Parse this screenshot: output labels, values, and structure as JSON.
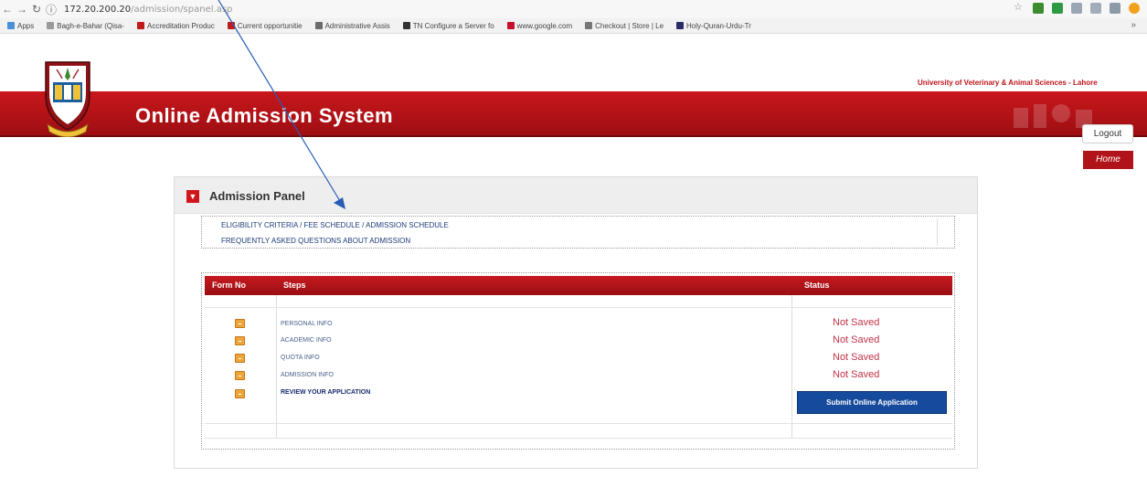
{
  "browser": {
    "url_host": "172.20.200.20",
    "url_path": "/admission/spanel.asp",
    "bookmarks": [
      {
        "label": "Apps",
        "color": "#4a90d9"
      },
      {
        "label": "Bagh-e-Bahar (Qisa-",
        "color": "#9a9a9a"
      },
      {
        "label": "Accreditation Produc",
        "color": "#c21a1a"
      },
      {
        "label": "Current opportunitie",
        "color": "#c21a1a"
      },
      {
        "label": "Administrative Assis",
        "color": "#6b6b6b"
      },
      {
        "label": "TN Configure a Server fo",
        "color": "#333333"
      },
      {
        "label": "www.google.com",
        "color": "#c8102e"
      },
      {
        "label": "Checkout | Store | Le",
        "color": "#777777"
      },
      {
        "label": "Holy-Quran-Urdu-Tr",
        "color": "#2b2b6b"
      }
    ]
  },
  "site": {
    "university_name": "University of Veterinary & Animal Sciences - Lahore",
    "title": "Online Admission System",
    "logout_label": "Logout",
    "home_label": "Home"
  },
  "panel": {
    "title": "Admission Panel",
    "links": [
      "ELIGIBILITY CRITERIA / FEE SCHEDULE / ADMISSION SCHEDULE",
      "FREQUENTLY ASKED QUESTIONS ABOUT ADMISSION"
    ]
  },
  "steps_table": {
    "headers": [
      "Form No",
      "Steps",
      "Status"
    ],
    "rows": [
      {
        "label": "PERSONAL INFO",
        "status": "Not Saved"
      },
      {
        "label": "ACADEMIC INFO",
        "status": "Not Saved"
      },
      {
        "label": "QUOTA INFO",
        "status": "Not Saved"
      },
      {
        "label": "ADMISSION INFO",
        "status": "Not Saved"
      },
      {
        "label": "REVIEW YOUR APPLICATION",
        "status": ""
      }
    ],
    "submit_label": "Submit Online Application"
  },
  "colors": {
    "brand_red": "#c8171c",
    "link_blue": "#1e3c7a",
    "status_red": "#c0334a",
    "submit_blue": "#164a9c",
    "annotation_arrow": "#2a5cb8"
  }
}
